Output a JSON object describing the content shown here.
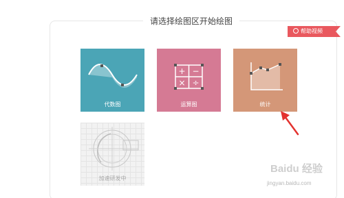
{
  "header": {
    "title": "请选择绘图区开始绘图"
  },
  "help": {
    "label": "帮助视频"
  },
  "cards": [
    {
      "label": "代数图",
      "icon": "sine-wave-icon"
    },
    {
      "label": "运算图",
      "icon": "calculator-icon"
    },
    {
      "label": "统计",
      "icon": "line-chart-icon"
    },
    {
      "label": "加速研发中",
      "icon": "compass-icon"
    }
  ],
  "watermark": {
    "brand": "Baidu 经验",
    "url": "jingyan.baidu.com"
  },
  "colors": {
    "algebra": "#4ba5b6",
    "calc": "#d57a94",
    "stat": "#d49778",
    "help_ribbon": "#e9585e",
    "arrow": "#e3322f"
  }
}
